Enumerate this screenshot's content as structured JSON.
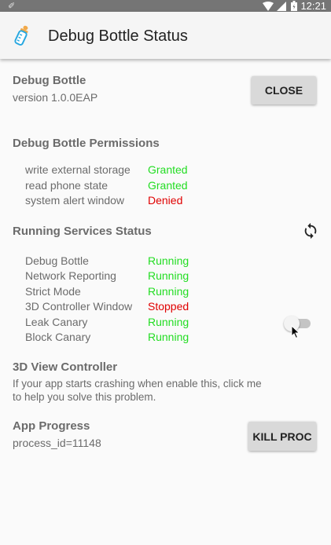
{
  "status_bar": {
    "time": "12:21"
  },
  "app_bar": {
    "title": "Debug Bottle Status",
    "icon": "baby-bottle-icon"
  },
  "about": {
    "title": "Debug Bottle",
    "version": "version 1.0.0EAP",
    "close_label": "CLOSE"
  },
  "permissions": {
    "title": "Debug Bottle Permissions",
    "items": [
      {
        "name": "write external storage",
        "status": "Granted"
      },
      {
        "name": "read phone state",
        "status": "Granted"
      },
      {
        "name": "system alert window",
        "status": "Denied"
      }
    ]
  },
  "services": {
    "title": "Running Services Status",
    "items": [
      {
        "name": "Debug Bottle",
        "status": "Running"
      },
      {
        "name": "Network Reporting",
        "status": "Running"
      },
      {
        "name": "Strict Mode",
        "status": "Running"
      },
      {
        "name": "3D Controller Window",
        "status": "Stopped"
      },
      {
        "name": "Leak Canary",
        "status": "Running"
      },
      {
        "name": "Block Canary",
        "status": "Running"
      }
    ]
  },
  "view_controller": {
    "title": "3D View Controller",
    "desc_line1": "If your app starts crashing when enable this, click me",
    "desc_line2": "to help you solve this problem.",
    "enabled": false
  },
  "app_progress": {
    "title": "App Progress",
    "process_id": "process_id=11148",
    "kill_label": "KILL PROC"
  },
  "colors": {
    "positive": "#22dd22",
    "negative": "#e00000",
    "accent": "#29a8e0"
  }
}
